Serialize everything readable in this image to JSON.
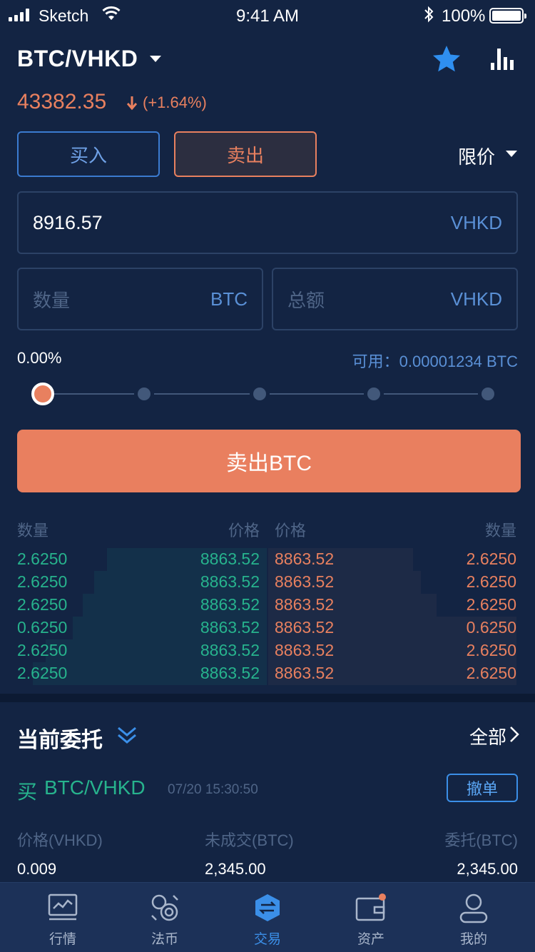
{
  "status_bar": {
    "carrier": "Sketch",
    "time": "9:41 AM",
    "battery": "100%"
  },
  "header": {
    "pair": "BTC/VHKD",
    "price": "43382.35",
    "change": "(+1.64%)"
  },
  "trade": {
    "buy_label": "买入",
    "sell_label": "卖出",
    "order_type": "限价",
    "price_value": "8916.57",
    "price_unit": "VHKD",
    "qty_placeholder": "数量",
    "qty_unit": "BTC",
    "total_placeholder": "总额",
    "total_unit": "VHKD",
    "percent": "0.00%",
    "available": "可用：0.00001234 BTC",
    "slider_value": 0,
    "submit_label": "卖出BTC"
  },
  "orderbook": {
    "headers": {
      "bid_qty": "数量",
      "bid_price": "价格",
      "ask_price": "价格",
      "ask_qty": "数量"
    },
    "rows": [
      {
        "bid_qty": "2.6250",
        "bid_price": "8863.52",
        "ask_price": "8863.52",
        "ask_qty": "2.6250"
      },
      {
        "bid_qty": "2.6250",
        "bid_price": "8863.52",
        "ask_price": "8863.52",
        "ask_qty": "2.6250"
      },
      {
        "bid_qty": "2.6250",
        "bid_price": "8863.52",
        "ask_price": "8863.52",
        "ask_qty": "2.6250"
      },
      {
        "bid_qty": "0.6250",
        "bid_price": "8863.52",
        "ask_price": "8863.52",
        "ask_qty": "0.6250"
      },
      {
        "bid_qty": "2.6250",
        "bid_price": "8863.52",
        "ask_price": "8863.52",
        "ask_qty": "2.6250"
      },
      {
        "bid_qty": "2.6250",
        "bid_price": "8863.52",
        "ask_price": "8863.52",
        "ask_qty": "2.6250"
      }
    ]
  },
  "orders": {
    "title": "当前委托",
    "all_label": "全部",
    "item": {
      "side": "买",
      "pair": "BTC/VHKD",
      "time": "07/20 15:30:50",
      "cancel_label": "撤单",
      "price_label": "价格(VHKD)",
      "unfilled_label": "未成交(BTC)",
      "amount_label": "委托(BTC)",
      "price": "0.009",
      "unfilled": "2,345.00",
      "amount": "2,345.00"
    }
  },
  "tabbar": {
    "items": [
      {
        "label": "行情",
        "icon": "market-chart-icon"
      },
      {
        "label": "法币",
        "icon": "fiat-currency-icon"
      },
      {
        "label": "交易",
        "icon": "trade-exchange-icon"
      },
      {
        "label": "资产",
        "icon": "wallet-icon"
      },
      {
        "label": "我的",
        "icon": "profile-icon"
      }
    ],
    "active": 2
  },
  "colors": {
    "background": "#132443",
    "accent_sell": "#e8805f",
    "accent_buy": "#27b38d",
    "accent_blue": "#3b8fe8"
  }
}
